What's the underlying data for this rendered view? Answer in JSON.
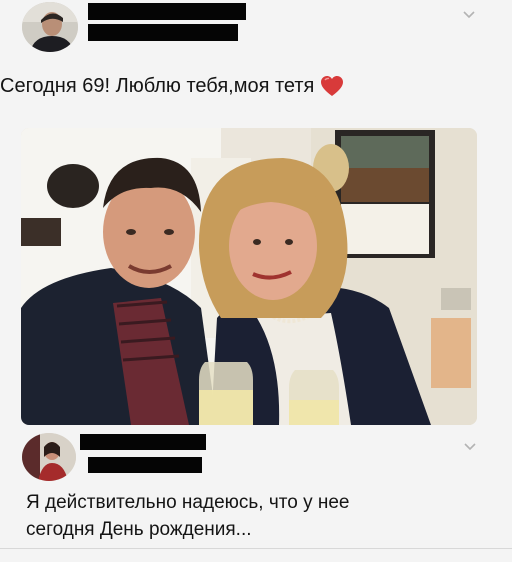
{
  "tweet": {
    "author_name": "",
    "author_handle": "",
    "text": "Сегодня 69! Люблю тебя,моя тетя",
    "emoji": "heart-emoji",
    "photo": "selfie-photo"
  },
  "reply": {
    "author_name": "",
    "author_handle": "",
    "text_line1": "Я действительно надеюсь, что у нее",
    "text_line2": "сегодня День рождения..."
  },
  "icons": {
    "menu": "chevron-down-icon"
  },
  "colors": {
    "background": "#f4f4f4",
    "text": "#141414",
    "redaction": "#050505",
    "heart": "#d83a3a"
  }
}
